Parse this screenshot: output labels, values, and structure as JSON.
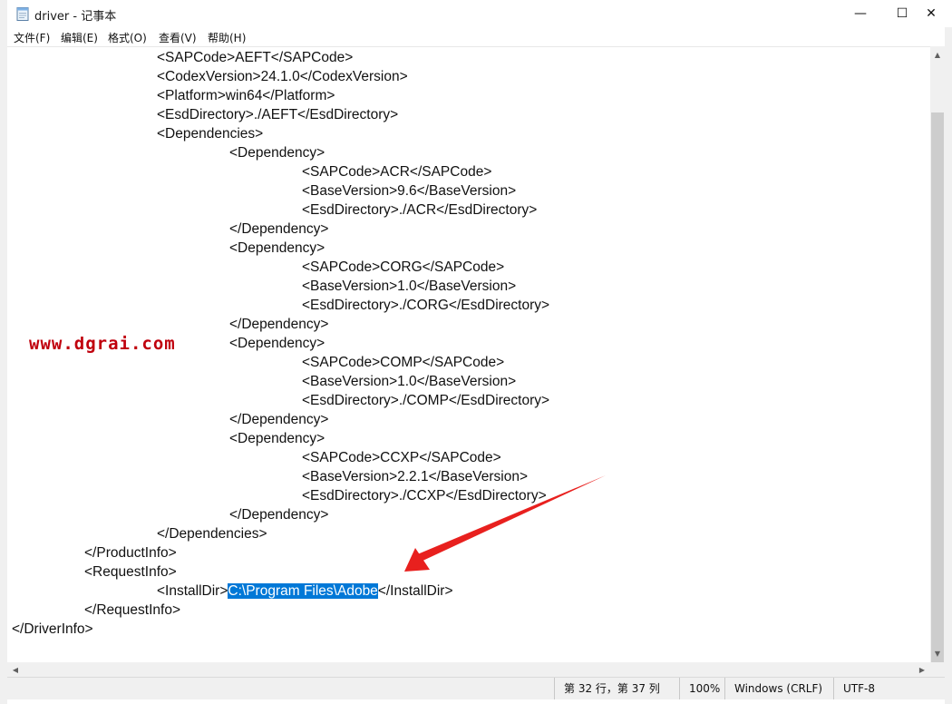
{
  "window": {
    "title": "driver - 记事本",
    "controls": {
      "minimize": "—",
      "maximize": "☐",
      "close": "✕"
    }
  },
  "menu": [
    {
      "id": "file",
      "label": "文件(F)"
    },
    {
      "id": "edit",
      "label": "编辑(E)"
    },
    {
      "id": "format",
      "label": "格式(O)"
    },
    {
      "id": "view",
      "label": "查看(V)"
    },
    {
      "id": "help",
      "label": "帮助(H)"
    }
  ],
  "editor": {
    "lines": [
      {
        "indent": 2,
        "text": "<SAPCode>AEFT</SAPCode>"
      },
      {
        "indent": 2,
        "text": "<CodexVersion>24.1.0</CodexVersion>"
      },
      {
        "indent": 2,
        "text": "<Platform>win64</Platform>"
      },
      {
        "indent": 2,
        "text": "<EsdDirectory>./AEFT</EsdDirectory>"
      },
      {
        "indent": 2,
        "text": "<Dependencies>"
      },
      {
        "indent": 3,
        "text": "<Dependency>"
      },
      {
        "indent": 4,
        "text": "<SAPCode>ACR</SAPCode>"
      },
      {
        "indent": 4,
        "text": "<BaseVersion>9.6</BaseVersion>"
      },
      {
        "indent": 4,
        "text": "<EsdDirectory>./ACR</EsdDirectory>"
      },
      {
        "indent": 3,
        "text": "</Dependency>"
      },
      {
        "indent": 3,
        "text": "<Dependency>"
      },
      {
        "indent": 4,
        "text": "<SAPCode>CORG</SAPCode>"
      },
      {
        "indent": 4,
        "text": "<BaseVersion>1.0</BaseVersion>"
      },
      {
        "indent": 4,
        "text": "<EsdDirectory>./CORG</EsdDirectory>"
      },
      {
        "indent": 3,
        "text": "</Dependency>"
      },
      {
        "indent": 3,
        "text": "<Dependency>"
      },
      {
        "indent": 4,
        "text": "<SAPCode>COMP</SAPCode>"
      },
      {
        "indent": 4,
        "text": "<BaseVersion>1.0</BaseVersion>"
      },
      {
        "indent": 4,
        "text": "<EsdDirectory>./COMP</EsdDirectory>"
      },
      {
        "indent": 3,
        "text": "</Dependency>"
      },
      {
        "indent": 3,
        "text": "<Dependency>"
      },
      {
        "indent": 4,
        "text": "<SAPCode>CCXP</SAPCode>"
      },
      {
        "indent": 4,
        "text": "<BaseVersion>2.2.1</BaseVersion>"
      },
      {
        "indent": 4,
        "text": "<EsdDirectory>./CCXP</EsdDirectory>"
      },
      {
        "indent": 3,
        "text": "</Dependency>"
      },
      {
        "indent": 2,
        "text": "</Dependencies>"
      },
      {
        "indent": 1,
        "text": "</ProductInfo>"
      },
      {
        "indent": 1,
        "text": "<RequestInfo>"
      },
      {
        "indent": 2,
        "text": "<InstallDir>",
        "selected": "C:\\Program Files\\Adobe",
        "after": "</InstallDir>"
      },
      {
        "indent": 1,
        "text": "</RequestInfo>"
      },
      {
        "indent": 0,
        "text": "</DriverInfo>"
      }
    ]
  },
  "status": {
    "position": "第 32 行，第 37 列",
    "zoom": "100%",
    "line_ending": "Windows (CRLF)",
    "encoding": "UTF-8"
  },
  "watermark": "www.dgrai.com",
  "colors": {
    "selection": "#0078d7",
    "watermark": "#c0000d",
    "annotation_arrow": "#e8201e"
  }
}
